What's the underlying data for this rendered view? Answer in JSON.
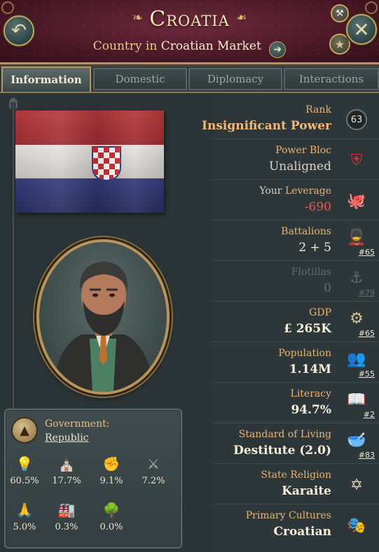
{
  "header": {
    "title": "Croatia",
    "subtitle_type": "Country",
    "subtitle_in": "in",
    "subtitle_market": "Croatian Market"
  },
  "tabs": [
    {
      "label": "Information",
      "active": true
    },
    {
      "label": "Domestic",
      "active": false
    },
    {
      "label": "Diplomacy",
      "active": false
    },
    {
      "label": "Interactions",
      "active": false
    }
  ],
  "flag": {
    "colors": [
      "#b73a3c",
      "#e7e4e1",
      "#353d7c"
    ],
    "coat_of_arms": "checkerboard-shield-icon"
  },
  "government": {
    "label": "Government:",
    "type": "Republic",
    "interest_groups": [
      {
        "icon": "lightbulb-icon",
        "value": "60.5%",
        "color": "#e6c24a"
      },
      {
        "icon": "institution-icon",
        "value": "17.7%",
        "color": "#5b8fd6"
      },
      {
        "icon": "worker-icon",
        "value": "9.1%",
        "color": "#d9534f"
      },
      {
        "icon": "crossed-swords-icon",
        "value": "7.2%",
        "color": "#b7b3a8"
      },
      {
        "icon": "praying-hands-icon",
        "value": "5.0%",
        "color": "#4fb89b"
      },
      {
        "icon": "factory-icon",
        "value": "0.3%",
        "color": "#d07a3c"
      },
      {
        "icon": "tree-icon",
        "value": "0.0%",
        "color": "#6fbf5a"
      }
    ]
  },
  "stats": {
    "rank": {
      "label": "Rank",
      "value": "Insignificant Power",
      "badge": "63"
    },
    "power_bloc": {
      "label": "Power Bloc",
      "value": "Unaligned"
    },
    "leverage": {
      "label_pre": "Your",
      "label_post": "Leverage",
      "value": "-690"
    },
    "battalions": {
      "label": "Battalions",
      "value": "2 + 5",
      "rank": "#65"
    },
    "flotillas": {
      "label": "Flotillas",
      "value": "0",
      "rank": "#79"
    },
    "gdp": {
      "label": "GDP",
      "value": "£ 265K",
      "rank": "#65"
    },
    "population": {
      "label": "Population",
      "value": "1.14M",
      "rank": "#55"
    },
    "literacy": {
      "label": "Literacy",
      "value": "94.7%",
      "rank": "#2"
    },
    "sol": {
      "label": "Standard of Living",
      "value": "Destitute (2.0)",
      "rank": "#83"
    },
    "religion": {
      "label": "State Religion",
      "value": "Karaite"
    },
    "cultures": {
      "label": "Primary Cultures",
      "value": "Croatian"
    }
  }
}
